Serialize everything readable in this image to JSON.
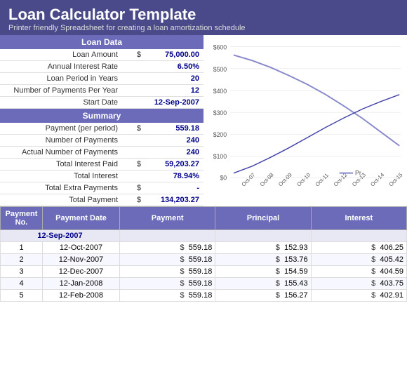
{
  "header": {
    "title": "Loan Calculator Template",
    "subtitle": "Printer friendly Spreadsheet for creating a loan amortization schedule"
  },
  "loanData": {
    "sectionTitle": "Loan Data",
    "rows": [
      {
        "label": "Loan Amount",
        "dollar": "$",
        "value": "75,000.00"
      },
      {
        "label": "Annual Interest Rate",
        "dollar": "",
        "value": "6.50%"
      },
      {
        "label": "Loan Period in Years",
        "dollar": "",
        "value": "20"
      },
      {
        "label": "Number of Payments Per Year",
        "dollar": "",
        "value": "12"
      },
      {
        "label": "Start Date",
        "dollar": "",
        "value": "12-Sep-2007"
      }
    ]
  },
  "summary": {
    "sectionTitle": "Summary",
    "rows": [
      {
        "label": "Payment (per period)",
        "dollar": "$",
        "value": "559.18"
      },
      {
        "label": "Number of Payments",
        "dollar": "",
        "value": "240"
      },
      {
        "label": "Actual Number of Payments",
        "dollar": "",
        "value": "240"
      },
      {
        "label": "Total Interest Paid",
        "dollar": "$",
        "value": "59,203.27"
      },
      {
        "label": "Total Interest",
        "dollar": "",
        "value": "78.94%"
      },
      {
        "label": "Total Extra Payments",
        "dollar": "$",
        "value": "-"
      },
      {
        "label": "Total Payment",
        "dollar": "$",
        "value": "134,203.27"
      }
    ]
  },
  "chart": {
    "yLabels": [
      "$600",
      "$500",
      "$400",
      "$300",
      "$200",
      "$100",
      "$0"
    ],
    "xLabels": [
      "Oct-07",
      "Oct-08",
      "Oct-09",
      "Oct-10",
      "Oct-11",
      "Oct-12",
      "Oct-13",
      "Oct-14",
      "Oct-15"
    ],
    "legend": "Pr"
  },
  "amortTable": {
    "columns": [
      "Payment No.",
      "Payment Date",
      "Payment",
      "Principal",
      "Interest"
    ],
    "dateHeaderRow": "12-Sep-2007",
    "rows": [
      {
        "no": "1",
        "date": "12-Oct-2007",
        "payment": "559.18",
        "principal": "152.93",
        "interest": "406.25"
      },
      {
        "no": "2",
        "date": "12-Nov-2007",
        "payment": "559.18",
        "principal": "153.76",
        "interest": "405.42"
      },
      {
        "no": "3",
        "date": "12-Dec-2007",
        "payment": "559.18",
        "principal": "154.59",
        "interest": "404.59"
      },
      {
        "no": "4",
        "date": "12-Jan-2008",
        "payment": "559.18",
        "principal": "155.43",
        "interest": "403.75"
      },
      {
        "no": "5",
        "date": "12-Feb-2008",
        "payment": "559.18",
        "principal": "156.27",
        "interest": "402.91"
      }
    ]
  }
}
